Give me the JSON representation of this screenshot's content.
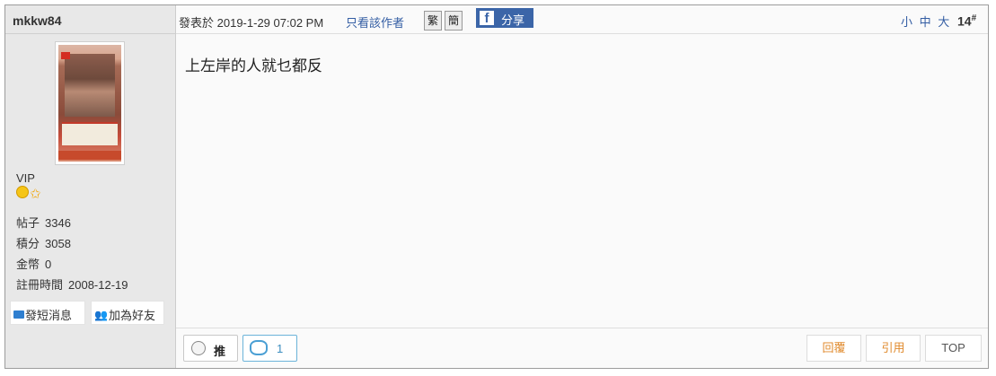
{
  "user": {
    "name": "mkkw84",
    "group": "VIP",
    "medals": [
      "smile-medal-icon",
      "star-medal-icon"
    ],
    "stats": [
      {
        "label": "帖子",
        "value": "3346"
      },
      {
        "label": "積分",
        "value": "3058"
      },
      {
        "label": "金幣",
        "value": "0"
      },
      {
        "label": "註冊時間",
        "value": "2008-12-19"
      }
    ],
    "actions": {
      "message": "發短消息",
      "add_friend": "加為好友"
    }
  },
  "post": {
    "posted_prefix": "發表於",
    "posted_time": "2019-1-29 07:02 PM",
    "only_author": "只看該作者",
    "trad_label": "繁",
    "simp_label": "簡",
    "share_label": "分享",
    "font_sizes": [
      "小",
      "中",
      "大"
    ],
    "floor": "14",
    "floor_mark": "#",
    "content": "上左岸的人就乜都反"
  },
  "footer": {
    "push_label": "推",
    "boo_count": "1",
    "reply_label": "回覆",
    "quote_label": "引用",
    "top_label": "TOP"
  },
  "colors": {
    "link": "#335da3",
    "facebook": "#3b65a8",
    "side_bg": "#e8e8e8",
    "action_orange": "#e08a2c"
  }
}
